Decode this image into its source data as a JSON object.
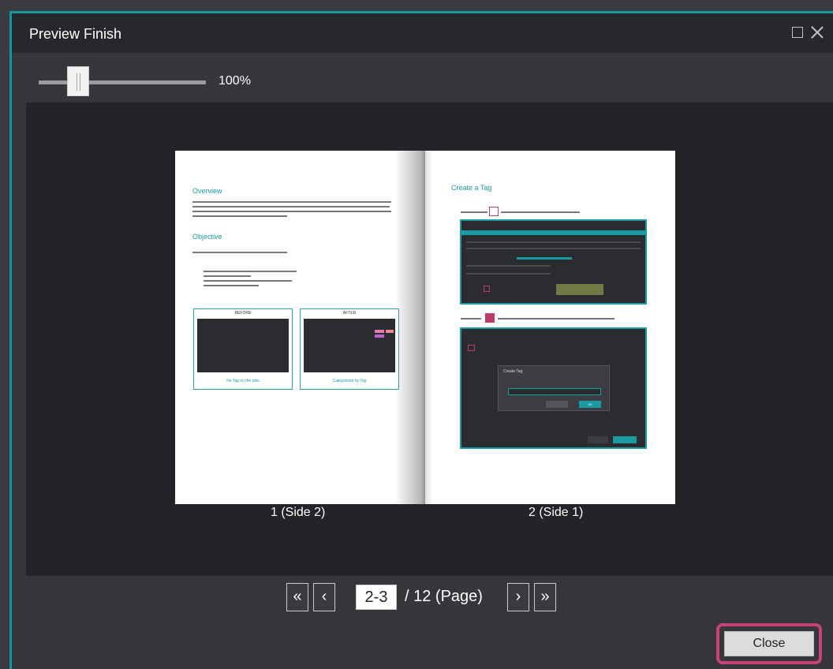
{
  "window": {
    "title": "Preview Finish"
  },
  "zoom": {
    "value_label": "100%"
  },
  "document": {
    "left_page": {
      "overview_heading": "Overview",
      "objective_heading": "Objective",
      "before_label": "BEFORE",
      "after_label": "AFTER",
      "before_caption": "No Tag on the jobs",
      "after_caption": "Categorized by Tag",
      "caption": "1 (Side 2)"
    },
    "right_page": {
      "heading": "Create a Tag",
      "dialog_title": "Create Tag",
      "dialog_ok": "OK",
      "caption": "2 (Side 1)"
    }
  },
  "pager": {
    "first_label": "«",
    "prev_label": "‹",
    "current_page": "2-3",
    "total_label": "/ 12 (Page)",
    "next_label": "›",
    "last_label": "»"
  },
  "footer": {
    "close_label": "Close"
  }
}
